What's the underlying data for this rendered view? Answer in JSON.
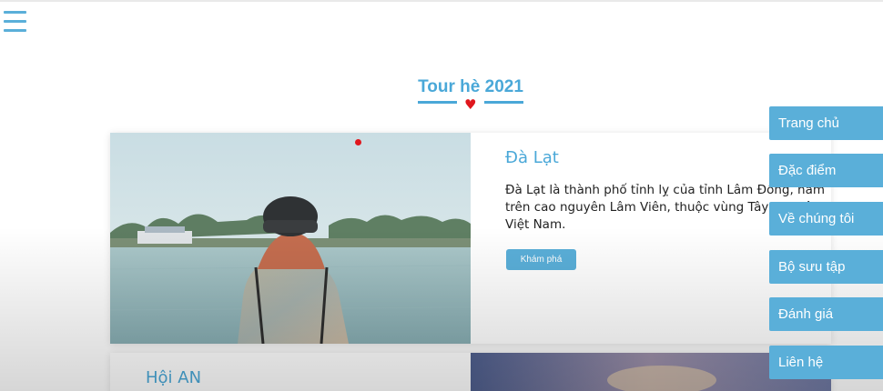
{
  "section": {
    "title": "Tour hè 2021"
  },
  "tours": [
    {
      "name": "Đà Lạt",
      "description": "Đà Lạt là thành phố tỉnh lỵ của tỉnh Lâm Đồng, nằm trên cao nguyên Lâm Viên, thuộc vùng Tây Nguyên, Việt Nam.",
      "button_label": "Khám phá"
    },
    {
      "name": "Hội AN"
    }
  ],
  "side_nav": {
    "items": [
      {
        "label": "Trang chủ"
      },
      {
        "label": "Đặc điểm"
      },
      {
        "label": "Về chúng tôi"
      },
      {
        "label": "Bộ sưu tập"
      },
      {
        "label": "Đánh giá"
      },
      {
        "label": "Liên hệ"
      }
    ]
  },
  "icons": {
    "menu": "hamburger-menu-icon",
    "heart": "heart-icon"
  },
  "colors": {
    "accent": "#5aafd9",
    "title": "#4aa8d8",
    "heart": "#e0171d"
  }
}
